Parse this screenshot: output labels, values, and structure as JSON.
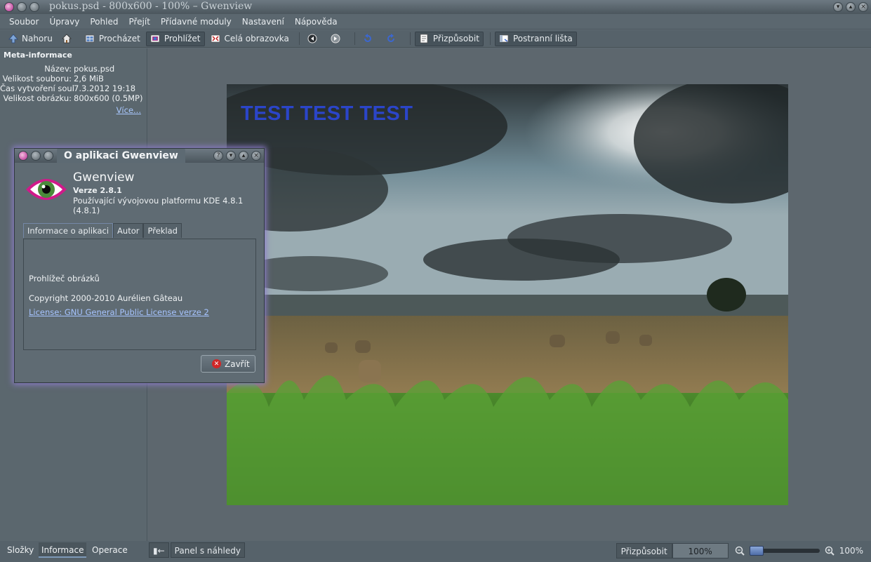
{
  "window": {
    "title": "pokus.psd - 800x600 - 100% – Gwenview"
  },
  "menu": [
    "Soubor",
    "Úpravy",
    "Pohled",
    "Přejít",
    "Přídavné moduly",
    "Nastavení",
    "Nápověda"
  ],
  "toolbar": {
    "up": "Nahoru",
    "browse": "Procházet",
    "view": "Prohlížet",
    "fullscreen": "Celá obrazovka",
    "fit": "Přizpůsobit",
    "sidebar": "Postranní lišta"
  },
  "meta_panel": {
    "title": "Meta-informace",
    "rows": [
      {
        "key": "Název:",
        "value": "pokus.psd"
      },
      {
        "key": "Velikost souboru:",
        "value": "2,6 MiB"
      },
      {
        "key": "Čas vytvoření soub:",
        "value": "7.3.2012 19:18"
      },
      {
        "key": "Velikost obrázku:",
        "value": "800x600 (0.5MP)"
      }
    ],
    "more_link": "Více..."
  },
  "bottom_tabs": [
    "Složky",
    "Informace",
    "Operace"
  ],
  "thumbnail_bar": {
    "toggle_icon": "▮←",
    "label": "Panel s náhledy"
  },
  "zoom": {
    "fit_label": "Přizpůsobit",
    "value": "100%",
    "label": "100%"
  },
  "photo": {
    "overlay_text": "TEST TEST TEST"
  },
  "dialog": {
    "title": "O aplikaci Gwenview",
    "app_name": "Gwenview",
    "version": "Verze 2.8.1",
    "platform": "Používající vývojovou platformu KDE 4.8.1 (4.8.1)",
    "tabs": [
      "Informace o aplikaci",
      "Autor",
      "Překlad"
    ],
    "description": "Prohlížeč obrázků",
    "copyright": "Copyright 2000-2010 Aurélien Gâteau",
    "license": "License: GNU General Public License verze 2",
    "close": "Zavřít"
  }
}
